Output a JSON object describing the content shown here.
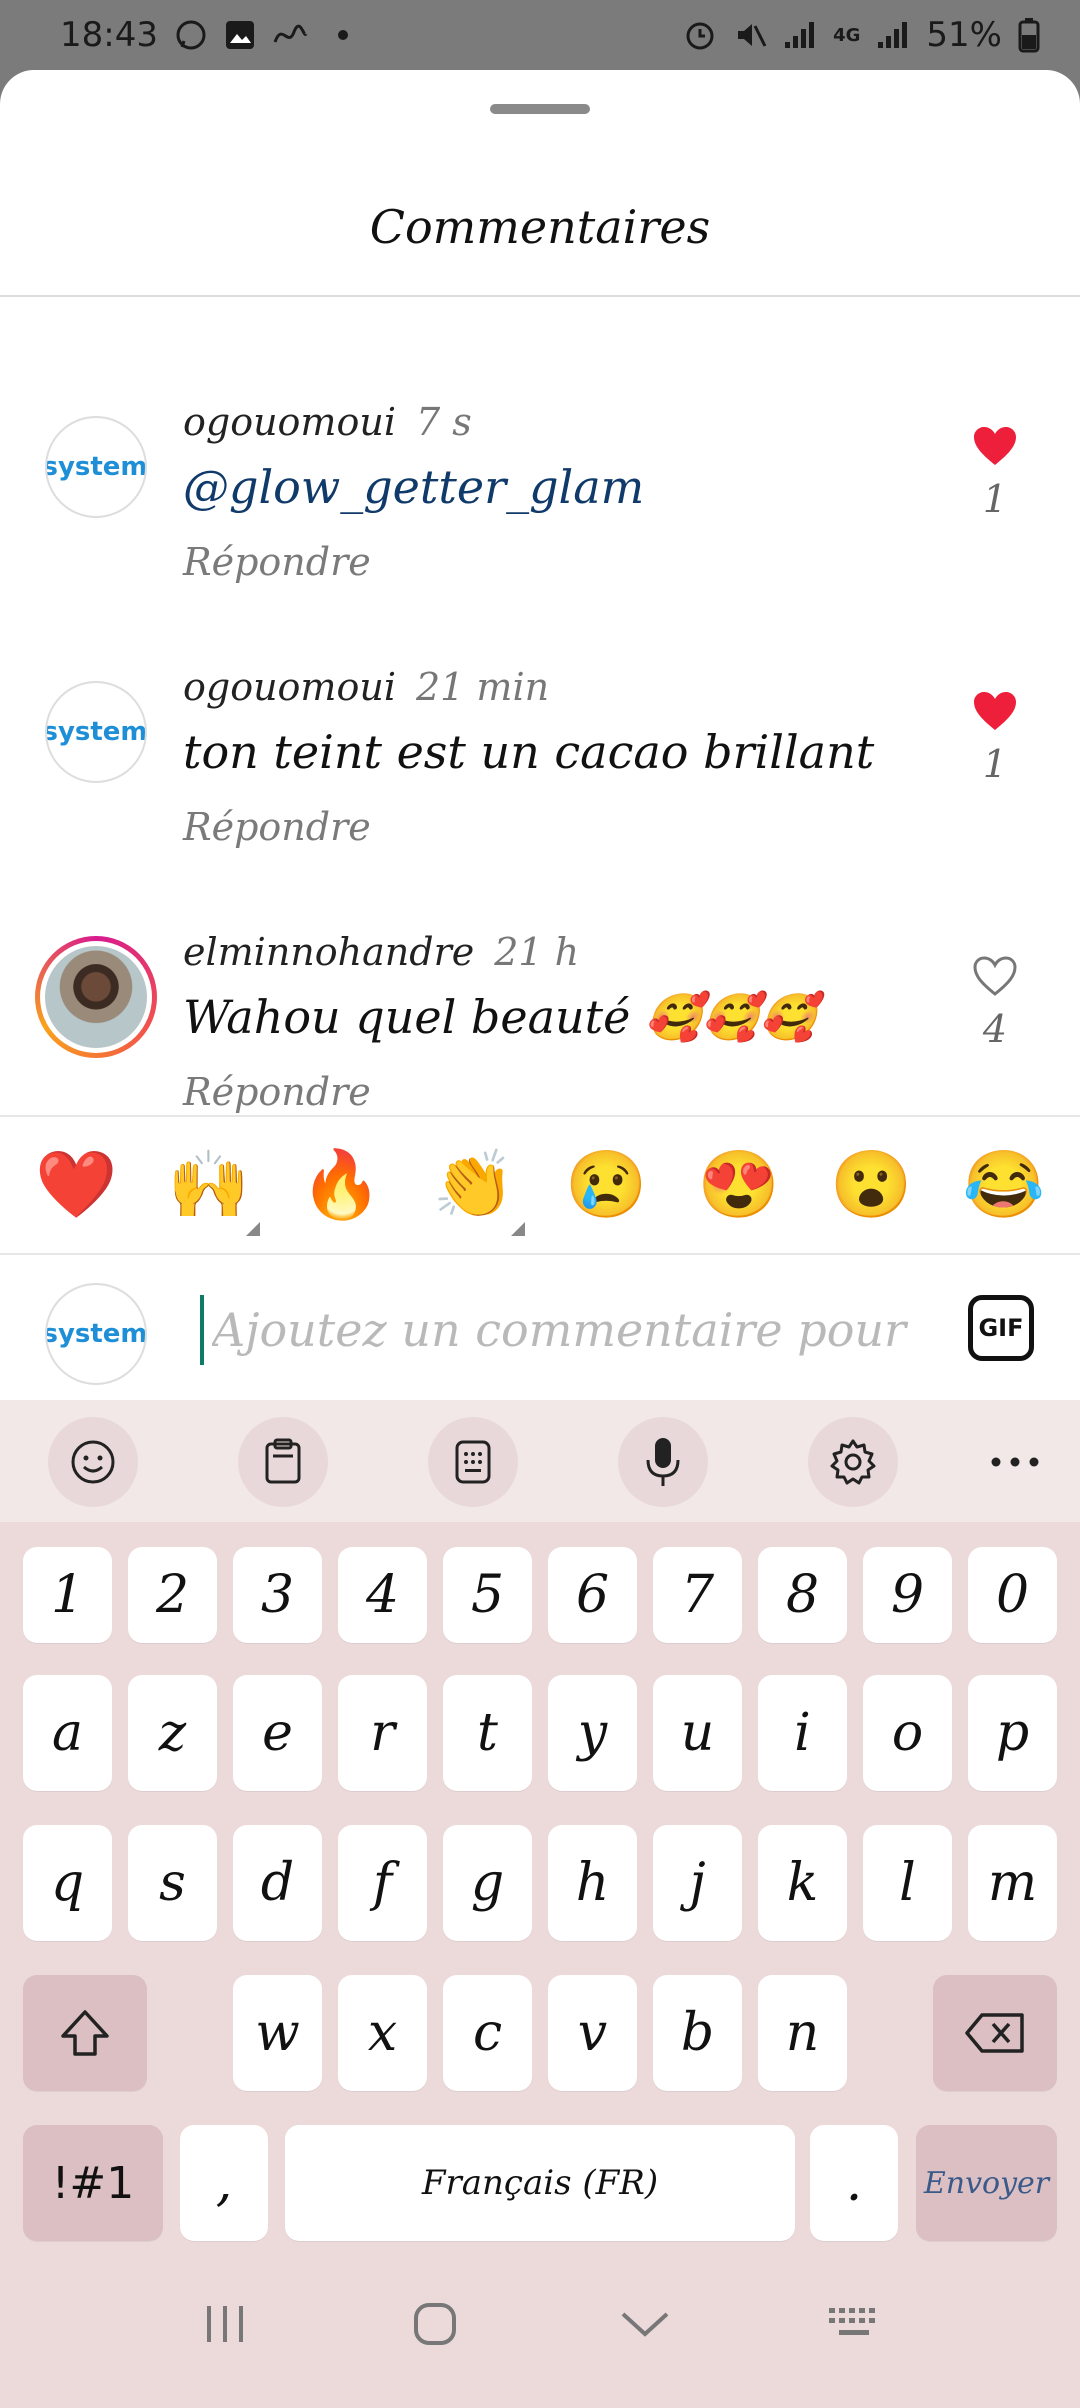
{
  "status_bar": {
    "time": "18:43",
    "battery": "51%"
  },
  "sheet": {
    "title": "Commentaires"
  },
  "comments": [
    {
      "avatar_text": "systeme",
      "username": "ogouomoui",
      "time": "7 s",
      "text": "@glow_getter_glam",
      "reply": "Répondre",
      "likes": "1",
      "liked": true
    },
    {
      "avatar_text": "systeme",
      "username": "ogouomoui",
      "time": "21 min",
      "text": "ton teint est un cacao brillant",
      "reply": "Répondre",
      "likes": "1",
      "liked": true
    },
    {
      "avatar_text": "",
      "username": "elminnohandre",
      "time": "21 h",
      "text": "Wahou quel beauté 🥰🥰🥰",
      "reply": "Répondre",
      "likes": "4",
      "liked": false
    }
  ],
  "reactions": [
    "❤️",
    "🙌",
    "🔥",
    "👏",
    "😢",
    "😍",
    "😮",
    "😂"
  ],
  "composer": {
    "avatar_text": "systeme",
    "placeholder": "Ajoutez un commentaire pour g",
    "gif_label": "GIF"
  },
  "keyboard": {
    "number_row": [
      "1",
      "2",
      "3",
      "4",
      "5",
      "6",
      "7",
      "8",
      "9",
      "0"
    ],
    "row1": [
      "a",
      "z",
      "e",
      "r",
      "t",
      "y",
      "u",
      "i",
      "o",
      "p"
    ],
    "row2": [
      "q",
      "s",
      "d",
      "f",
      "g",
      "h",
      "j",
      "k",
      "l",
      "m"
    ],
    "row3": [
      "w",
      "x",
      "c",
      "v",
      "b",
      "n"
    ],
    "symbols_label": "!#1",
    "comma": ",",
    "space_label": "Français (FR)",
    "period": ".",
    "send_label": "Envoyer"
  },
  "colors": {
    "like_red": "#ed1f3a",
    "mention_blue": "#103a6a",
    "keyboard_bg": "#ecdadb"
  }
}
